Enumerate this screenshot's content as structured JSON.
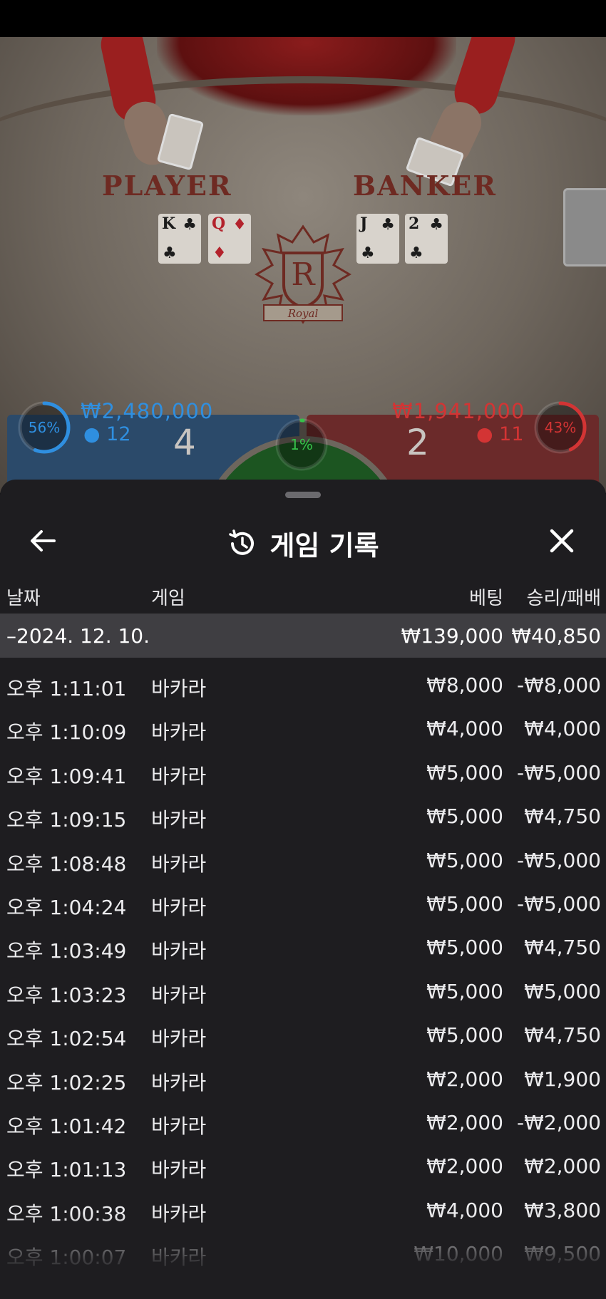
{
  "live_table": {
    "player_label": "PLAYER",
    "banker_label": "BANKER",
    "crest_letter": "R",
    "crest_word": "Royal",
    "player_cards": [
      {
        "rank": "K",
        "suit": "♣",
        "color": "black"
      },
      {
        "rank": "Q",
        "suit": "♦",
        "color": "red"
      }
    ],
    "banker_cards": [
      {
        "rank": "J",
        "suit": "♣",
        "color": "black"
      },
      {
        "rank": "2",
        "suit": "♣",
        "color": "black"
      }
    ],
    "player_bet": {
      "percent_label": "56%",
      "percent": 56,
      "amount": "₩2,480,000",
      "count": "12",
      "score": "4",
      "color": "#2f8fe0"
    },
    "tie_bet": {
      "percent_label": "1%",
      "percent": 1,
      "color": "#37c24a"
    },
    "banker_bet": {
      "percent_label": "43%",
      "percent": 43,
      "amount": "₩1,941,000",
      "count": "11",
      "score": "2",
      "color": "#d33434"
    }
  },
  "sheet": {
    "title": "게임 기록",
    "icons": {
      "back": "arrow-left-icon",
      "history": "history-icon",
      "close": "close-icon"
    },
    "columns": {
      "date": "날짜",
      "game": "게임",
      "bet": "베팅",
      "result": "승리/패배"
    },
    "day": {
      "label": "–2024. 12. 10.",
      "bet_total": "₩139,000",
      "result_total": "₩40,850"
    },
    "rows": [
      {
        "time": "오후 1:11:01",
        "game": "바카라",
        "bet": "₩8,000",
        "result": "-₩8,000"
      },
      {
        "time": "오후 1:10:09",
        "game": "바카라",
        "bet": "₩4,000",
        "result": "₩4,000"
      },
      {
        "time": "오후 1:09:41",
        "game": "바카라",
        "bet": "₩5,000",
        "result": "-₩5,000"
      },
      {
        "time": "오후 1:09:15",
        "game": "바카라",
        "bet": "₩5,000",
        "result": "₩4,750"
      },
      {
        "time": "오후 1:08:48",
        "game": "바카라",
        "bet": "₩5,000",
        "result": "-₩5,000"
      },
      {
        "time": "오후 1:04:24",
        "game": "바카라",
        "bet": "₩5,000",
        "result": "-₩5,000"
      },
      {
        "time": "오후 1:03:49",
        "game": "바카라",
        "bet": "₩5,000",
        "result": "₩4,750"
      },
      {
        "time": "오후 1:03:23",
        "game": "바카라",
        "bet": "₩5,000",
        "result": "₩5,000"
      },
      {
        "time": "오후 1:02:54",
        "game": "바카라",
        "bet": "₩5,000",
        "result": "₩4,750"
      },
      {
        "time": "오후 1:02:25",
        "game": "바카라",
        "bet": "₩2,000",
        "result": "₩1,900"
      },
      {
        "time": "오후 1:01:42",
        "game": "바카라",
        "bet": "₩2,000",
        "result": "-₩2,000"
      },
      {
        "time": "오후 1:01:13",
        "game": "바카라",
        "bet": "₩2,000",
        "result": "₩2,000"
      },
      {
        "time": "오후 1:00:38",
        "game": "바카라",
        "bet": "₩4,000",
        "result": "₩3,800"
      },
      {
        "time": "오후 1:00:07",
        "game": "바카라",
        "bet": "₩10,000",
        "result": "₩9,500"
      }
    ]
  }
}
